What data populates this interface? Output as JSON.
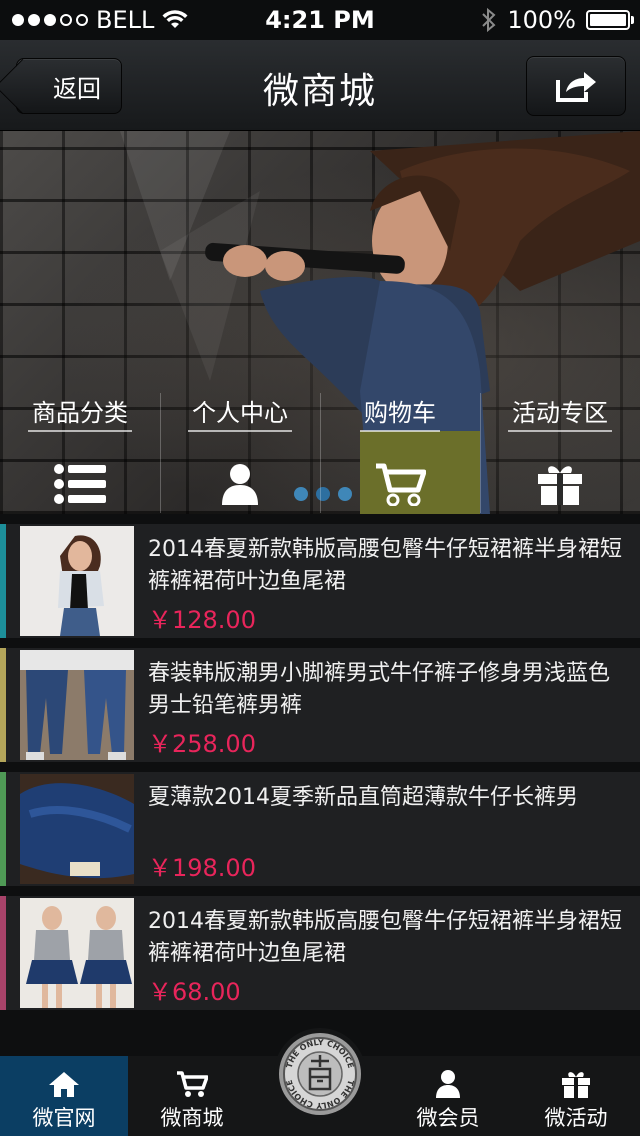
{
  "status_bar": {
    "carrier": "BELL",
    "time": "4:21 PM",
    "battery": "100%",
    "battery_level": 1.0,
    "signal_bars_filled": 3,
    "signal_bars_total": 5,
    "icons": [
      "wifi-icon",
      "bluetooth-icon",
      "battery-icon"
    ]
  },
  "navbar": {
    "back_label": "返回",
    "title": "微商城",
    "share_icon": "share-icon"
  },
  "hero": {
    "carousel_count": 3,
    "carousel_active": 1,
    "menu": [
      {
        "label": "商品分类",
        "icon": "list-icon"
      },
      {
        "label": "个人中心",
        "icon": "user-icon"
      },
      {
        "label": "购物车",
        "icon": "cart-icon"
      },
      {
        "label": "活动专区",
        "icon": "gift-icon"
      }
    ]
  },
  "products": [
    {
      "title": "2014春夏新款韩版高腰包臀牛仔短裙裤半身裙短裤裤裙荷叶边鱼尾裙",
      "price": "￥128.00",
      "accent": "#1d8f9a"
    },
    {
      "title": "春装韩版潮男小脚裤男式牛仔裤子修身男浅蓝色男士铅笔裤男裤",
      "price": "￥258.00",
      "accent": "#b3a55a"
    },
    {
      "title": "夏薄款2014夏季新品直筒超薄款牛仔长裤男",
      "price": "￥198.00",
      "accent": "#4f9a56"
    },
    {
      "title": "2014春夏新款韩版高腰包臀牛仔短裙裤半身裙短裤裤裙荷叶边鱼尾裙",
      "price": "￥68.00",
      "accent": "#a8436a"
    }
  ],
  "tabbar": {
    "tabs": [
      {
        "label": "微官网",
        "icon": "home-icon"
      },
      {
        "label": "微商城",
        "icon": "cart-icon"
      },
      {
        "label": "微会员",
        "icon": "user-icon"
      },
      {
        "label": "微活动",
        "icon": "gift-icon"
      }
    ],
    "center_logo_text": "THE ONLY CHOICE",
    "active_tab": "微官网"
  },
  "colors": {
    "price": "#e8255b",
    "tab_active": "#0b3e63",
    "carousel_dot": "#3f87b8"
  }
}
